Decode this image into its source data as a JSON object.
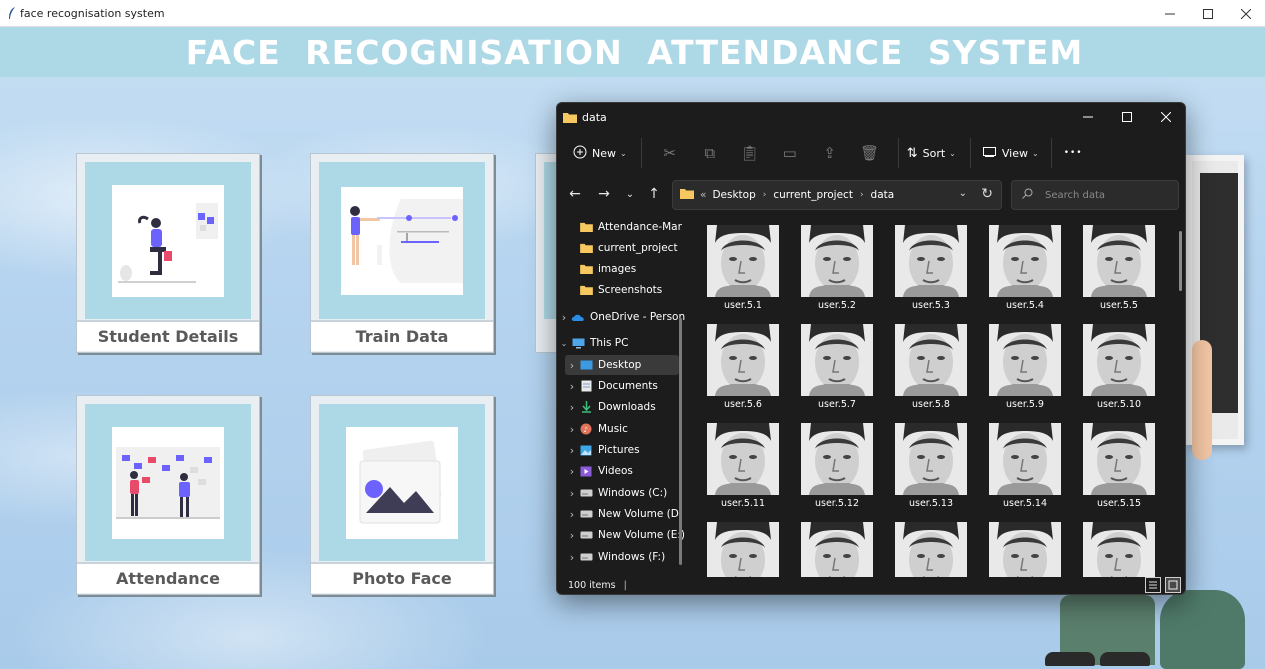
{
  "window": {
    "title": "face recognisation system",
    "controls": [
      "minimize",
      "maximize",
      "close"
    ]
  },
  "banner": {
    "title": "FACE  RECOGNISATION  ATTENDANCE  SYSTEM"
  },
  "tiles": [
    {
      "label": "Student Details",
      "icon": "student-illustration"
    },
    {
      "label": "Train Data",
      "icon": "presentation-illustration"
    },
    {
      "label": "Attendance",
      "icon": "board-illustration"
    },
    {
      "label": "Photo Face",
      "icon": "photo-icon"
    }
  ],
  "explorer": {
    "title": "data",
    "commands": {
      "new": "New",
      "sort": "Sort",
      "view": "View",
      "more": "•••"
    },
    "address": {
      "prefix": "«",
      "crumbs": [
        "Desktop",
        "current_project",
        "data"
      ]
    },
    "search_placeholder": "Search data",
    "sidebar": [
      {
        "label": "Attendance-Mar",
        "icon": "folder-icon",
        "expandable": false
      },
      {
        "label": "current_project",
        "icon": "folder-icon",
        "expandable": false
      },
      {
        "label": "images",
        "icon": "folder-icon",
        "expandable": false
      },
      {
        "label": "Screenshots",
        "icon": "folder-icon",
        "expandable": false
      },
      {
        "label": "OneDrive - Person",
        "icon": "onedrive-icon",
        "expandable": true
      },
      {
        "label": "This PC",
        "icon": "pc-icon",
        "expandable": true,
        "expanded": true
      },
      {
        "label": "Desktop",
        "icon": "desktop-icon",
        "expandable": true,
        "selected": true
      },
      {
        "label": "Documents",
        "icon": "documents-icon",
        "expandable": true
      },
      {
        "label": "Downloads",
        "icon": "downloads-icon",
        "expandable": true
      },
      {
        "label": "Music",
        "icon": "music-icon",
        "expandable": true
      },
      {
        "label": "Pictures",
        "icon": "pictures-icon",
        "expandable": true
      },
      {
        "label": "Videos",
        "icon": "videos-icon",
        "expandable": true
      },
      {
        "label": "Windows (C:)",
        "icon": "drive-icon",
        "expandable": true
      },
      {
        "label": "New Volume (D:",
        "icon": "drive-icon",
        "expandable": true
      },
      {
        "label": "New Volume (E:)",
        "icon": "drive-icon",
        "expandable": true
      },
      {
        "label": "Windows (F:)",
        "icon": "drive-icon",
        "expandable": true
      }
    ],
    "files": [
      "user.5.1",
      "user.5.2",
      "user.5.3",
      "user.5.4",
      "user.5.5",
      "user.5.6",
      "user.5.7",
      "user.5.8",
      "user.5.9",
      "user.5.10",
      "user.5.11",
      "user.5.12",
      "user.5.13",
      "user.5.14",
      "user.5.15",
      "",
      "",
      "",
      "",
      ""
    ],
    "status": "100 items",
    "status_sep": "|"
  },
  "colors": {
    "banner_bg": "#add8e6",
    "tile_pic_bg": "#add8e6",
    "explorer_bg": "#1c1c1c",
    "folder": "#f6c85f",
    "accent_purple": "#6c63ff"
  }
}
